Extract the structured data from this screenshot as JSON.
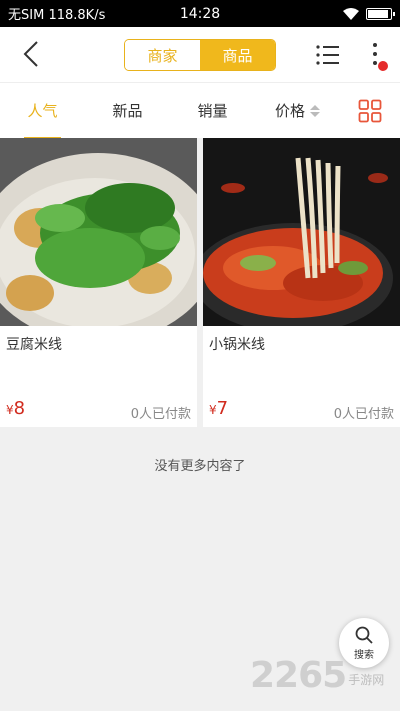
{
  "status_bar": {
    "carrier": "无SIM",
    "speed": "118.8K/s",
    "time": "14:28"
  },
  "header": {
    "segments": [
      {
        "label": "商家",
        "active": false
      },
      {
        "label": "商品",
        "active": true
      }
    ]
  },
  "tabs": [
    {
      "label": "人气",
      "active": true
    },
    {
      "label": "新品",
      "active": false
    },
    {
      "label": "销量",
      "active": false
    },
    {
      "label": "价格",
      "active": false
    }
  ],
  "products": [
    {
      "name": "豆腐米线",
      "currency": "¥",
      "price": "8",
      "sold": "0人已付款"
    },
    {
      "name": "小锅米线",
      "currency": "¥",
      "price": "7",
      "sold": "0人已付款"
    }
  ],
  "footer_text": "没有更多内容了",
  "search_fab": {
    "label": "搜索"
  },
  "watermark": {
    "number": "2265",
    "sub": "手游网"
  },
  "colors": {
    "accent": "#f0b81c",
    "price": "#d12b1e",
    "badge": "#e52b2b"
  }
}
